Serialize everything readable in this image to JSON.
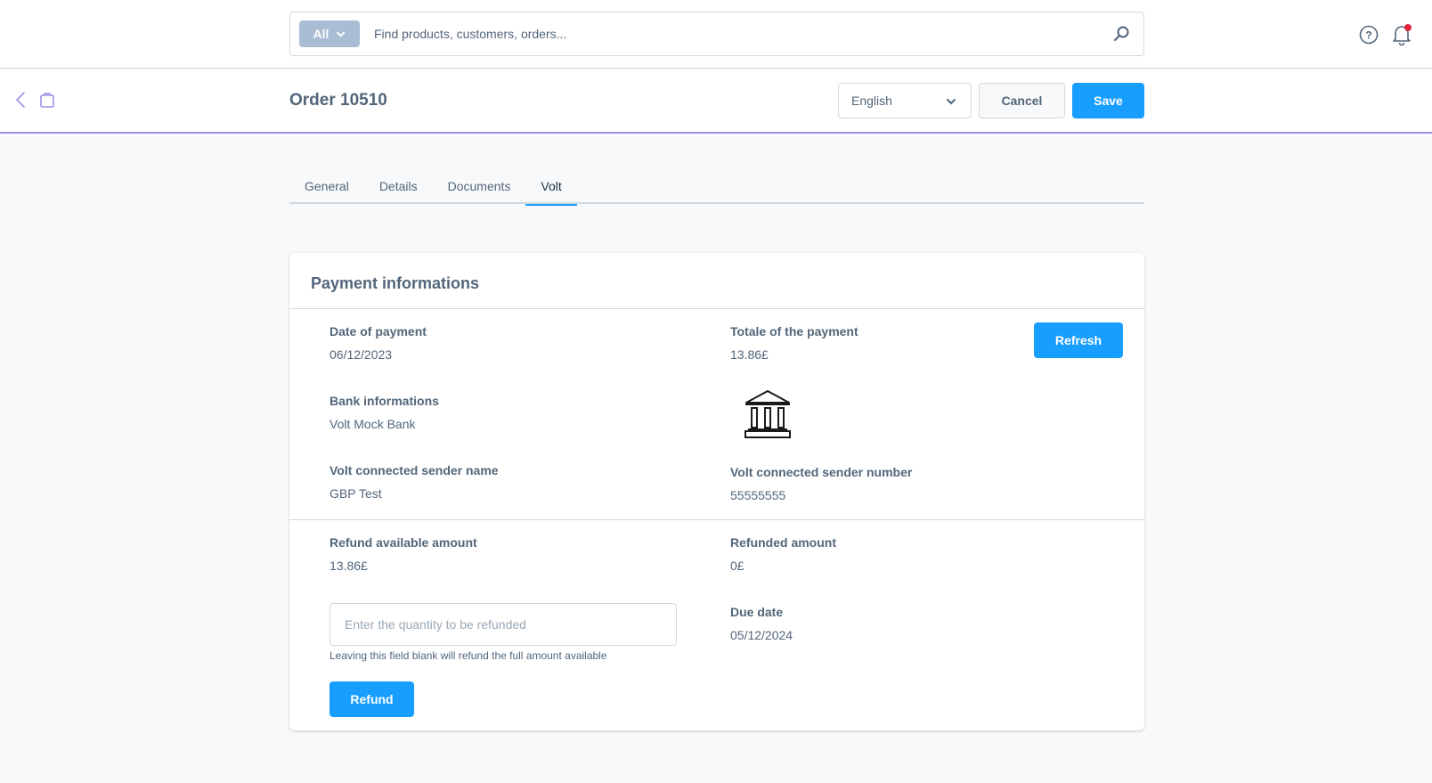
{
  "topbar": {
    "search_type": "All",
    "search_placeholder": "Find products, customers, orders...",
    "notification_dot_color": "#e4233e"
  },
  "header": {
    "title": "Order 10510",
    "language": "English",
    "cancel_label": "Cancel",
    "save_label": "Save",
    "accent_color": "#9f8fe4"
  },
  "tabs": [
    {
      "label": "General",
      "active": false
    },
    {
      "label": "Details",
      "active": false
    },
    {
      "label": "Documents",
      "active": false
    },
    {
      "label": "Volt",
      "active": true
    }
  ],
  "card": {
    "title": "Payment informations",
    "refresh_label": "Refresh",
    "payment": {
      "date_label": "Date of payment",
      "date_value": "06/12/2023",
      "total_label": "Totale of the payment",
      "total_value": "13.86£",
      "bank_label": "Bank informations",
      "bank_value": "Volt Mock Bank",
      "sender_name_label": "Volt connected sender name",
      "sender_name_value": "GBP Test",
      "sender_number_label": "Volt connected sender number",
      "sender_number_value": "55555555"
    },
    "refund": {
      "available_label": "Refund available amount",
      "available_value": "13.86£",
      "refunded_label": "Refunded amount",
      "refunded_value": "0£",
      "due_label": "Due date",
      "due_value": "05/12/2024",
      "input_placeholder": "Enter the quantity to be refunded",
      "input_value": "",
      "help_text": "Leaving this field blank will refund the full amount available",
      "button_label": "Refund"
    }
  }
}
